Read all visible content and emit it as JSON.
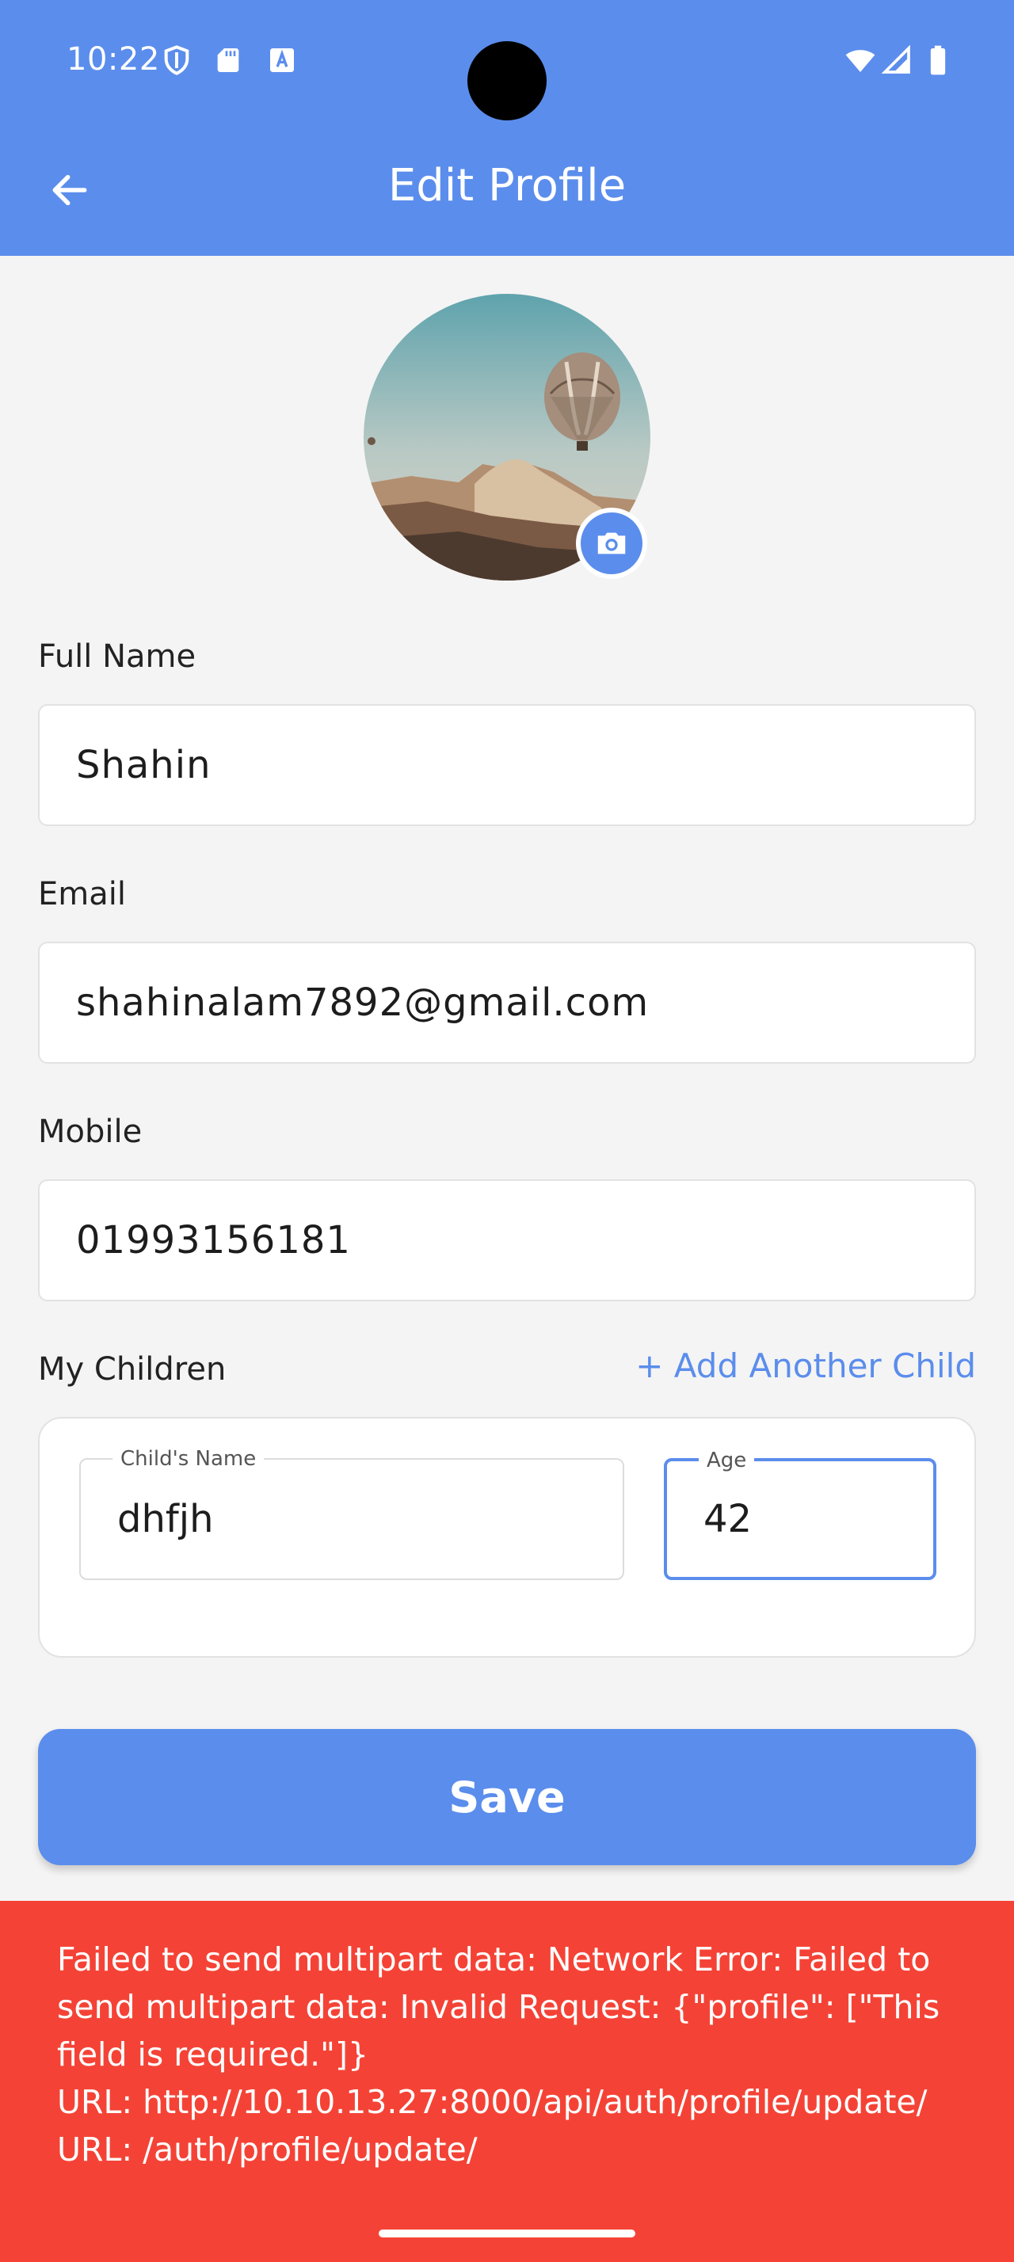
{
  "status_bar": {
    "time": "10:22"
  },
  "header": {
    "title": "Edit Profile"
  },
  "profile": {
    "full_name_label": "Full Name",
    "full_name_value": "Shahin",
    "email_label": "Email",
    "email_value": "shahinalam7892@gmail.com",
    "mobile_label": "Mobile",
    "mobile_value": "01993156181"
  },
  "children": {
    "section_label": "My Children",
    "add_link": "+ Add Another Child",
    "items": [
      {
        "name_label": "Child's Name",
        "name_value": "dhfjh",
        "age_label": "Age",
        "age_value": "42"
      }
    ]
  },
  "actions": {
    "save_label": "Save"
  },
  "error": {
    "message": "Failed to send multipart data: Network Error: Failed to send multipart data: Invalid Request: {\"profile\": [\"This field is required.\"]}\nURL: http://10.10.13.27:8000/api/auth/profile/update/\nURL: /auth/profile/update/"
  },
  "colors": {
    "primary": "#5b8dec",
    "error": "#f44336",
    "background": "#f4f4f4"
  },
  "icons": [
    "back-arrow-icon",
    "camera-icon",
    "shield-icon",
    "sd-card-icon",
    "font-icon",
    "wifi-icon",
    "signal-icon",
    "battery-icon"
  ]
}
